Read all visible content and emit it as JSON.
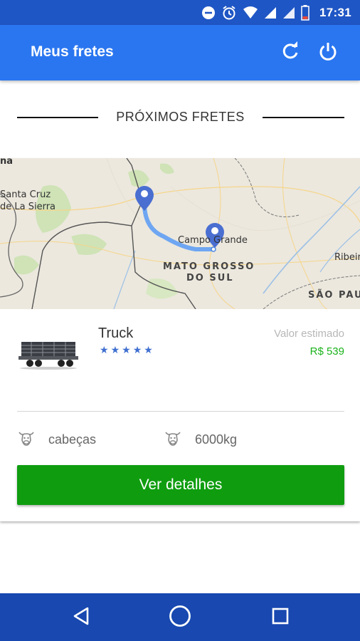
{
  "status_bar": {
    "time": "17:31",
    "icons": [
      "do-not-disturb-icon",
      "alarm-icon",
      "wifi-icon",
      "signal-icon",
      "signal-icon",
      "battery-icon"
    ]
  },
  "app_bar": {
    "title": "Meus fretes",
    "actions": [
      "refresh-icon",
      "power-icon"
    ]
  },
  "section": {
    "title": "PRÓXIMOS FRETES"
  },
  "freight": {
    "map": {
      "labels": {
        "top_left": "na",
        "city1_line1": "Santa Cruz",
        "city1_line2": "de La Sierra",
        "destination": "Campo Grande",
        "state_line1": "MATO GROSSO",
        "state_line2": "DO SUL",
        "right_city": "Ribeir",
        "bottom_right": "SÃO PAU"
      }
    },
    "vehicle": {
      "name": "Truck",
      "rating": 5,
      "stars": [
        "★",
        "★",
        "★",
        "★",
        "★"
      ]
    },
    "estimate": {
      "label": "Valor estimado",
      "value": "R$ 539"
    },
    "details": {
      "cargo": "cabeças",
      "weight": "6000kg"
    },
    "action_label": "Ver detalhes"
  },
  "nav_bar": {
    "buttons": [
      "back-icon",
      "home-icon",
      "recents-icon"
    ]
  },
  "colors": {
    "status_bar": "#1f56c5",
    "app_bar": "#2a76f0",
    "primary_button": "#0f9d0f",
    "estimate_value": "#1bb31b",
    "nav_bar": "#1848b0",
    "star": "#3f6fd0"
  }
}
